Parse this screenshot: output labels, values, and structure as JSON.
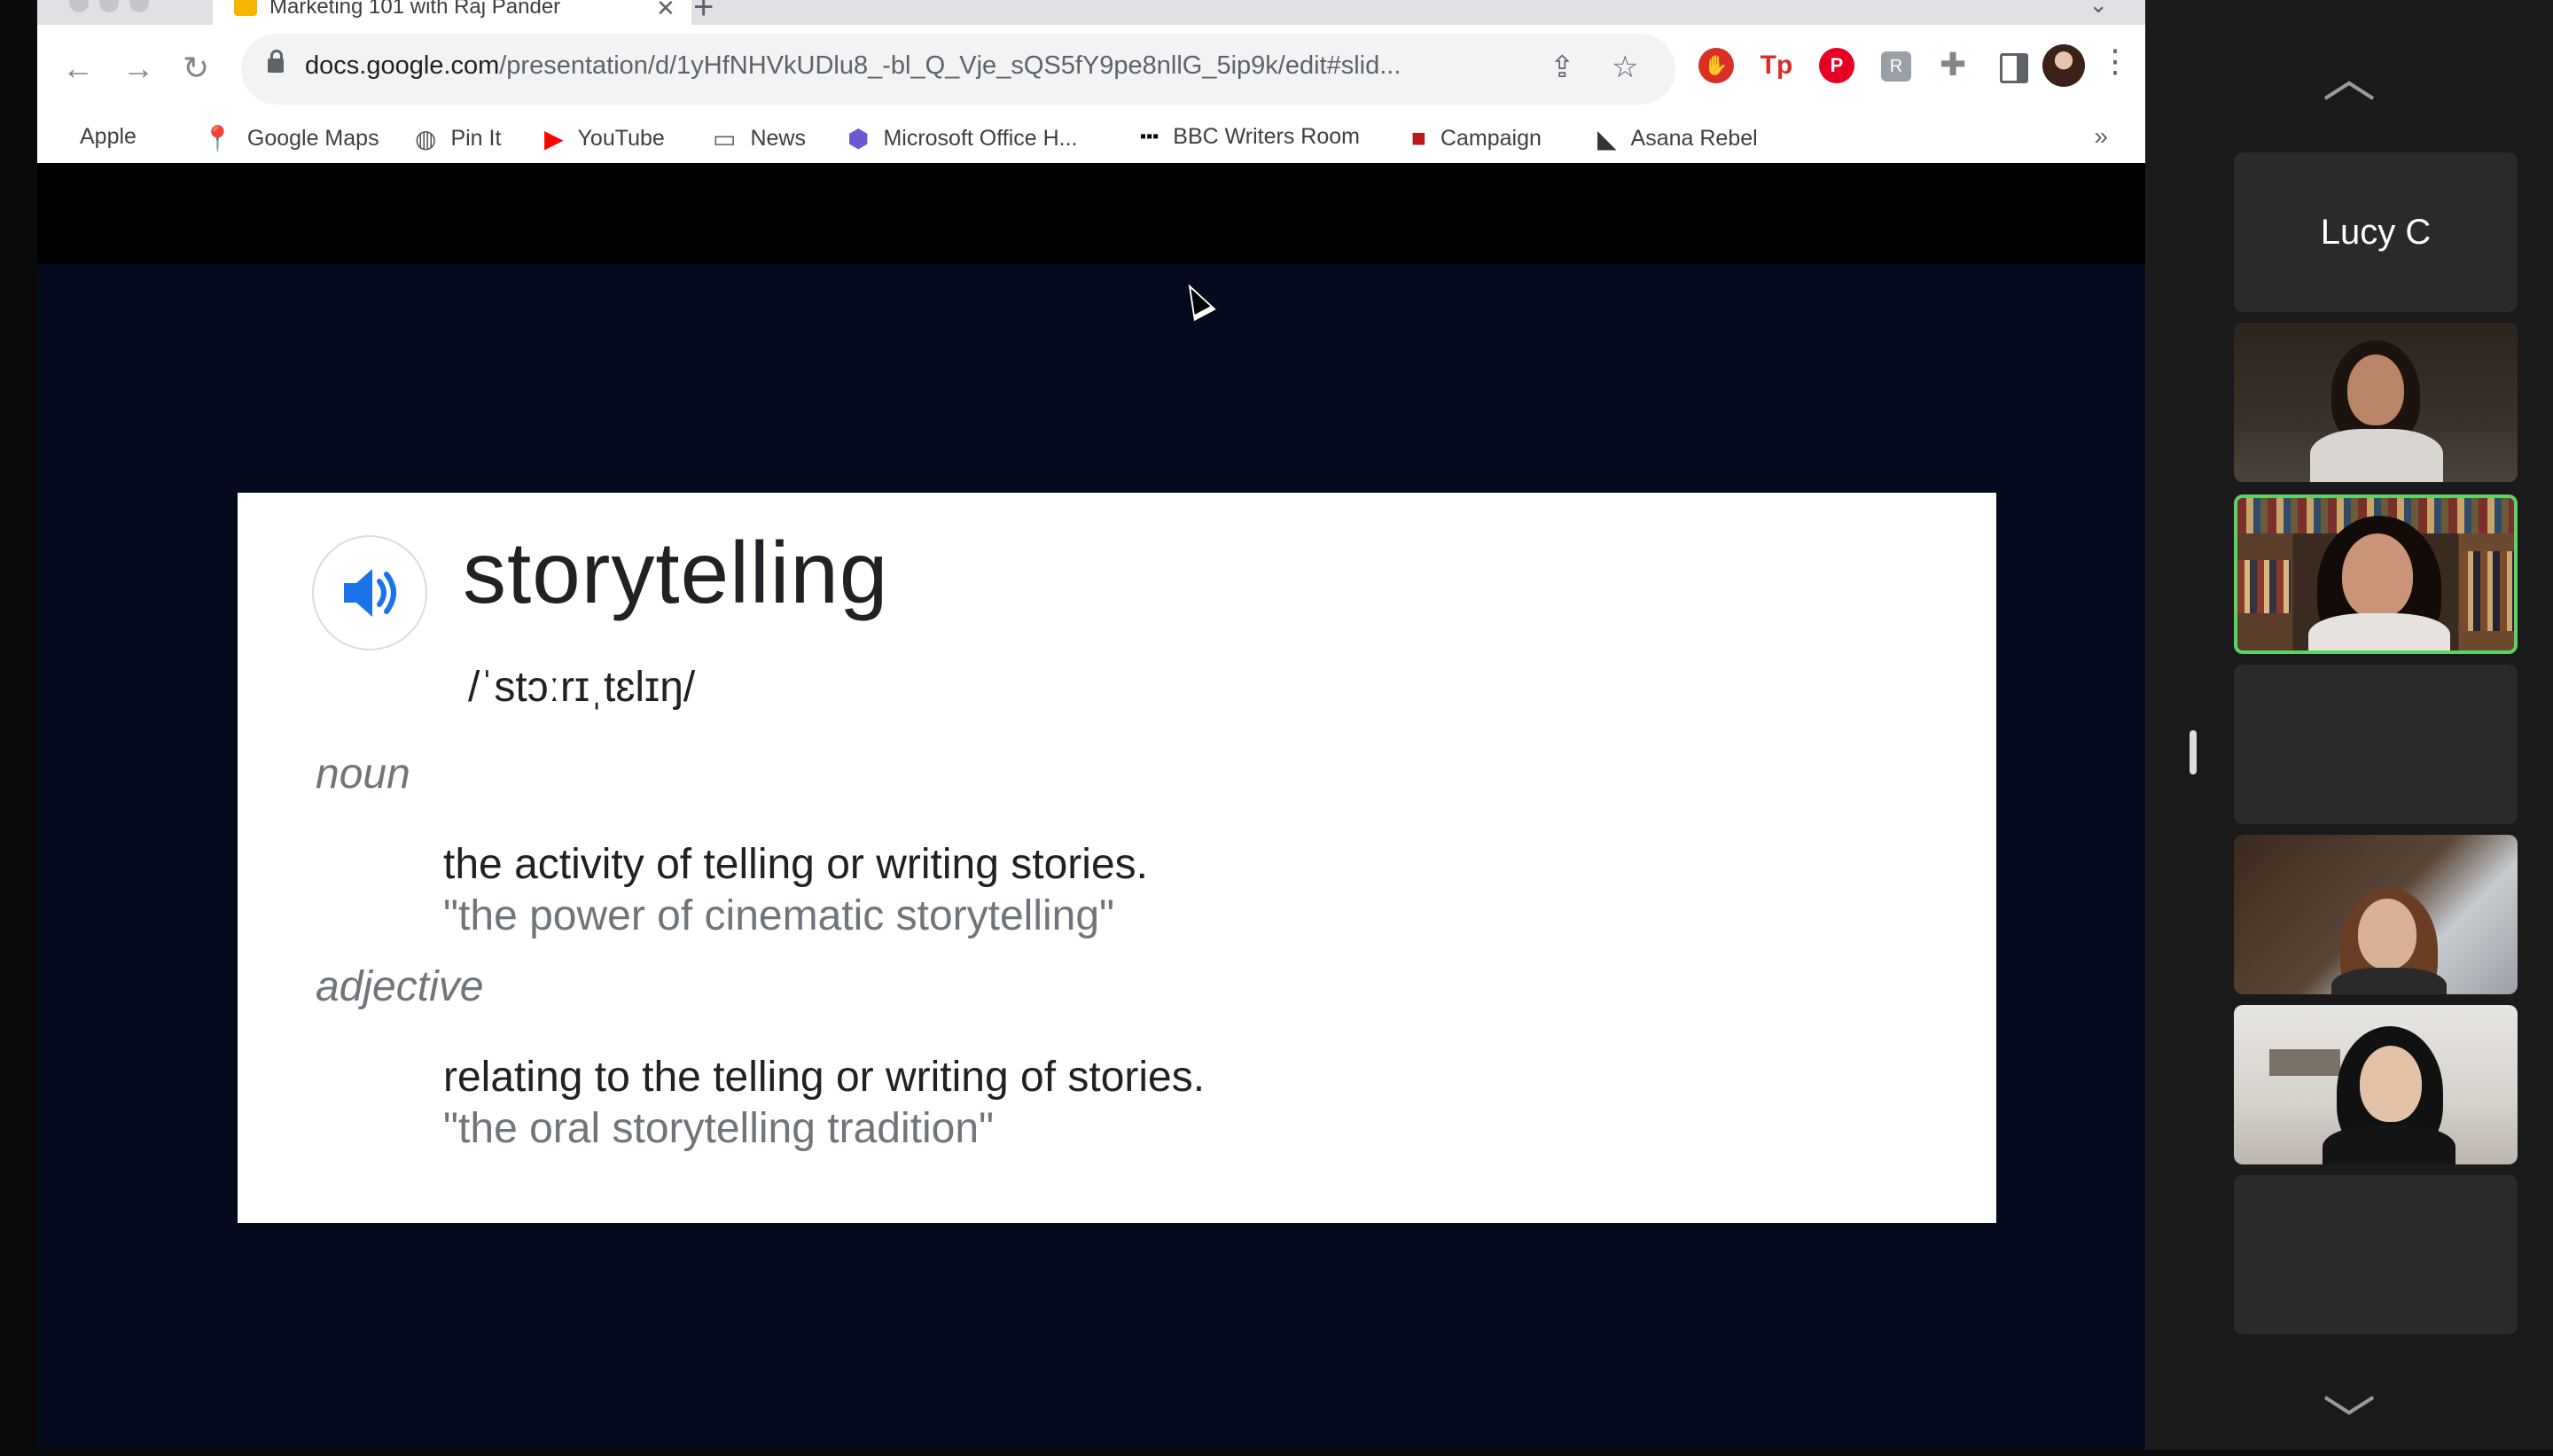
{
  "browser": {
    "tab_title": "Marketing 101 with Raj Pander",
    "url_host": "docs.google.com",
    "url_path": "/presentation/d/1yHfNHVkUDlu8_-bl_Q_Vje_sQS5fY9pe8nllG_5ip9k/edit#slid...",
    "bookmarks": [
      {
        "label": "Apple",
        "icon": "apple-icon"
      },
      {
        "label": "Google Maps",
        "icon": "maps-pin-icon"
      },
      {
        "label": "Pin It",
        "icon": "globe-icon"
      },
      {
        "label": "YouTube",
        "icon": "youtube-icon"
      },
      {
        "label": "News",
        "icon": "folder-icon"
      },
      {
        "label": "Microsoft Office H...",
        "icon": "office-icon"
      },
      {
        "label": "BBC Writers Room",
        "icon": "bbc-icon"
      },
      {
        "label": "Campaign",
        "icon": "campaign-icon"
      },
      {
        "label": "Asana Rebel",
        "icon": "asana-rebel-icon"
      }
    ],
    "extensions": [
      "adblock-icon",
      "tp-icon",
      "pinterest-icon",
      "extension-icon"
    ]
  },
  "slide": {
    "word": "storytelling",
    "phonetic": "/ˈstɔːrɪˌtɛlɪŋ/",
    "noun_label": "noun",
    "noun_def": "the activity of telling or writing stories.",
    "noun_example": "\"the power of cinematic storytelling\"",
    "adj_label": "adjective",
    "adj_def": "relating to the telling or writing of stories.",
    "adj_example": "\"the oral storytelling tradition\""
  },
  "meeting": {
    "participants": [
      {
        "name": "Lucy C",
        "video": false
      },
      {
        "name": "",
        "video": true
      },
      {
        "name": "",
        "video": true,
        "active_speaker": true
      },
      {
        "name": "",
        "video": false
      },
      {
        "name": "",
        "video": true
      },
      {
        "name": "",
        "video": true
      },
      {
        "name": "",
        "video": false
      }
    ],
    "accent_active": "#5bd365"
  }
}
